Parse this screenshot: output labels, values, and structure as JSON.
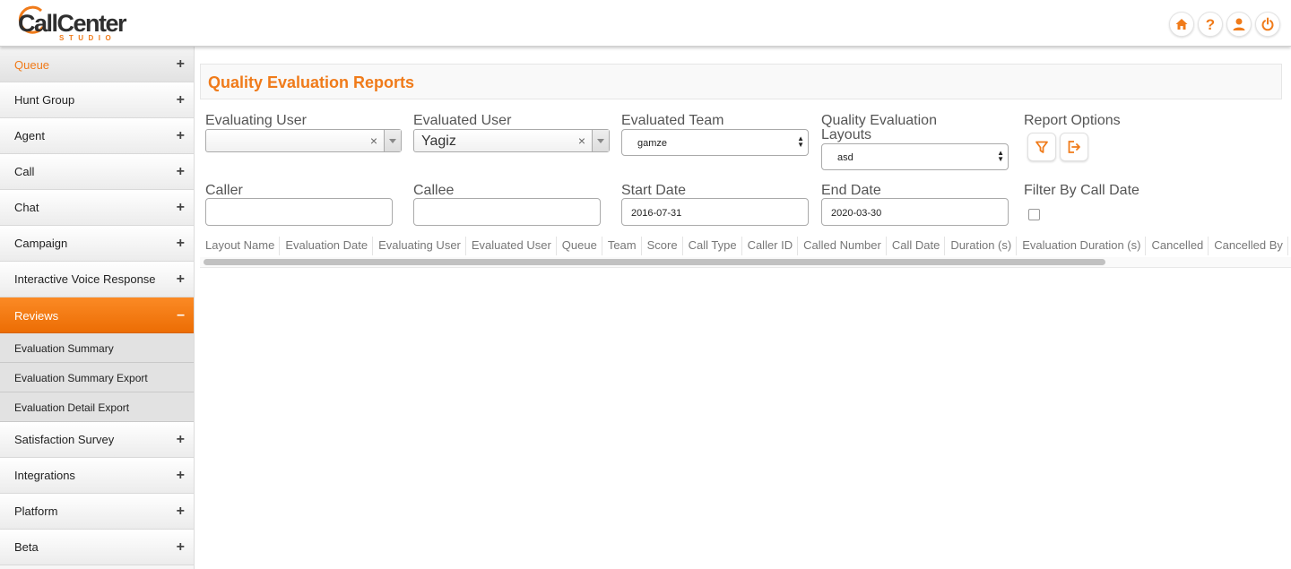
{
  "app": {
    "logo_main": "CallCenter",
    "logo_sub": "STUDIO",
    "accent_color": "#f07b1a"
  },
  "top_icons": [
    {
      "name": "home-icon"
    },
    {
      "name": "help-icon",
      "glyph": "?"
    },
    {
      "name": "user-icon"
    },
    {
      "name": "power-icon"
    }
  ],
  "sidebar": {
    "items": [
      {
        "label": "Queue",
        "state": "+"
      },
      {
        "label": "Hunt Group",
        "state": "+"
      },
      {
        "label": "Agent",
        "state": "+"
      },
      {
        "label": "Call",
        "state": "+"
      },
      {
        "label": "Chat",
        "state": "+"
      },
      {
        "label": "Campaign",
        "state": "+"
      },
      {
        "label": "Interactive Voice Response",
        "state": "+"
      },
      {
        "label": "Reviews",
        "state": "–"
      },
      {
        "label": "Satisfaction Survey",
        "state": "+"
      },
      {
        "label": "Integrations",
        "state": "+"
      },
      {
        "label": "Platform",
        "state": "+"
      },
      {
        "label": "Beta",
        "state": "+"
      }
    ],
    "reviews_subitems": [
      {
        "label": "Evaluation Summary"
      },
      {
        "label": "Evaluation Summary Export"
      },
      {
        "label": "Evaluation Detail Export"
      }
    ]
  },
  "page": {
    "title": "Quality Evaluation Reports"
  },
  "filters": {
    "evaluating_user": {
      "label": "Evaluating User",
      "value": "",
      "clear": "×"
    },
    "evaluated_user": {
      "label": "Evaluated User",
      "value": "Yagiz",
      "clear": "×"
    },
    "evaluated_team": {
      "label": "Evaluated Team",
      "value": "gamze"
    },
    "layouts": {
      "label_line1": "Quality Evaluation",
      "label_line2": "Layouts",
      "value": "asd"
    },
    "report_options": {
      "label": "Report Options"
    },
    "caller": {
      "label": "Caller",
      "value": ""
    },
    "callee": {
      "label": "Callee",
      "value": ""
    },
    "start_date": {
      "label": "Start Date",
      "value": "2016-07-31"
    },
    "end_date": {
      "label": "End Date",
      "value": "2020-03-30"
    },
    "filter_by_call_date": {
      "label": "Filter By Call Date",
      "checked": false
    }
  },
  "table": {
    "columns": [
      "Layout Name",
      "Evaluation Date",
      "Evaluating User",
      "Evaluated User",
      "Queue",
      "Team",
      "Score",
      "Call Type",
      "Caller ID",
      "Called Number",
      "Call Date",
      "Duration (s)",
      "Evaluation Duration (s)",
      "Cancelled",
      "Cancelled By"
    ]
  }
}
